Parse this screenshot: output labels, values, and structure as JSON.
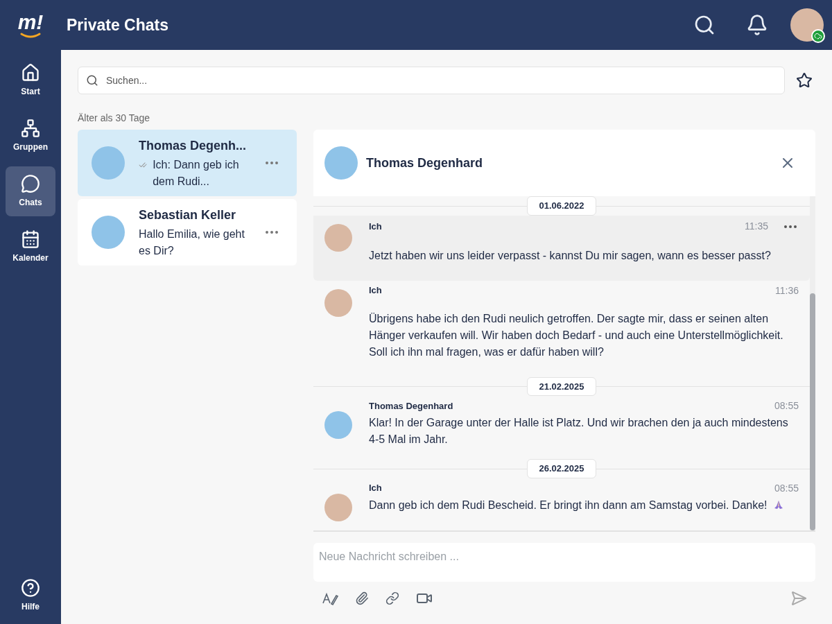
{
  "header": {
    "logo": "m!",
    "title": "Private Chats",
    "online": true
  },
  "sidebar": {
    "items": [
      {
        "kind": "home",
        "label": "Start",
        "selected": false
      },
      {
        "kind": "groups",
        "label": "Gruppen",
        "selected": false
      },
      {
        "kind": "chats",
        "label": "Chats",
        "selected": true
      },
      {
        "kind": "calendar",
        "label": "Kalender",
        "selected": false
      }
    ],
    "help": {
      "label": "Hilfe"
    }
  },
  "search": {
    "placeholder": "Suchen..."
  },
  "section_label": "Älter als 30 Tage",
  "conversations": [
    {
      "name": "Thomas Degenh...",
      "preview": "Ich: Dann geb ich dem Rudi...",
      "read": true,
      "selected": true
    },
    {
      "name": "Sebastian Keller",
      "preview": "Hallo Emilia, wie geht es Dir?",
      "read": false,
      "selected": false
    }
  ],
  "chat": {
    "title": "Thomas Degenhard",
    "messages": [
      {
        "kind": "date",
        "text": "01.06.2022"
      },
      {
        "kind": "message",
        "sender": "Ich",
        "time": "11:35",
        "text": "Jetzt haben wir uns leider verpasst - kannst Du mir sagen, wann es besser passt?",
        "outgoing": true,
        "hovered": true,
        "spaced": true
      },
      {
        "kind": "message",
        "sender": "Ich",
        "time": "11:36",
        "text": "Übrigens habe ich den Rudi neulich getroffen. Der sagte mir, dass er seinen alten Hänger verkaufen will. Wir haben doch Bedarf - und auch eine Unterstellmöglichkeit. Soll ich ihn mal fragen, was er dafür haben will?",
        "outgoing": true,
        "hovered": false,
        "spaced": true
      },
      {
        "kind": "date",
        "text": "21.02.2025"
      },
      {
        "kind": "message",
        "sender": "Thomas Degenhard",
        "time": "08:55",
        "text": "Klar! In der Garage unter der Halle ist Platz. Und wir brachen den ja auch mindestens 4-5 Mal im Jahr.",
        "outgoing": false,
        "hovered": false,
        "spaced": false
      },
      {
        "kind": "date",
        "text": "26.02.2025"
      },
      {
        "kind": "message",
        "sender": "Ich",
        "time": "08:55",
        "text": "Dann geb ich dem Rudi Bescheid. Er bringt ihn dann am Samstag vorbei. Danke!",
        "outgoing": true,
        "hovered": false,
        "spaced": false,
        "emoji": true
      }
    ]
  },
  "composer": {
    "placeholder": "Neue Nachricht schreiben ..."
  }
}
